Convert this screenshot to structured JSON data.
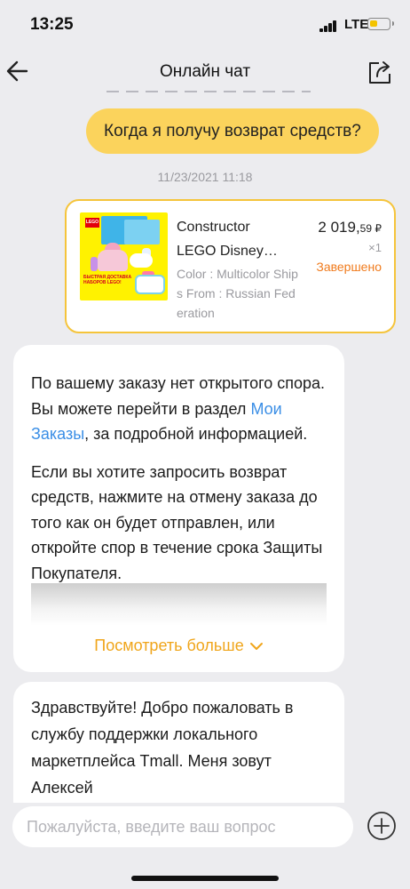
{
  "status_bar": {
    "time": "13:25",
    "network": "LTE",
    "battery_level": 0.4,
    "icons": [
      "signal-icon",
      "battery-icon"
    ]
  },
  "header": {
    "title": "Онлайн чат",
    "back_icon": "arrow-left-icon",
    "share_icon": "share-icon"
  },
  "messages": {
    "user_message": "Когда я получу возврат средств?",
    "timestamp": "11/23/2021 11:18",
    "product": {
      "title": "Constructor LEGO Disney…",
      "attributes": "Color : Multicolor Ships From : Russian Federation",
      "price_int": "2 019,",
      "price_frac": "59 ₽",
      "quantity": "×1",
      "status": "Завершено",
      "image_text": "БЫСТРАЯ ДОСТАВКА НАБОРОВ LEGO!",
      "brand_logo": "LEGO"
    },
    "bot_reply": {
      "p1_before": "По вашему заказу нет открытого спора. Вы можете перейти в раздел ",
      "p1_link": "Мои Заказы",
      "p1_after": ", за подробной информацией.",
      "p2": "Если вы хотите запросить возврат средств, нажмите на отмену заказа до того как он будет отправлен, или откройте спор в течение срока Защиты Покупателя.",
      "more_label": "Посмотреть больше"
    },
    "greeting": "Здравствуйте! Добро пожаловать в службу поддержки локального маркетплейса Tmall. Меня зовут Алексей"
  },
  "input": {
    "placeholder": "Пожалуйста, введите ваш вопрос",
    "value": ""
  },
  "colors": {
    "accent": "#fbd35c",
    "card_border": "#f5c43b",
    "status": "#f07b1d",
    "link": "#3a8ee6",
    "more": "#f0a51a"
  }
}
